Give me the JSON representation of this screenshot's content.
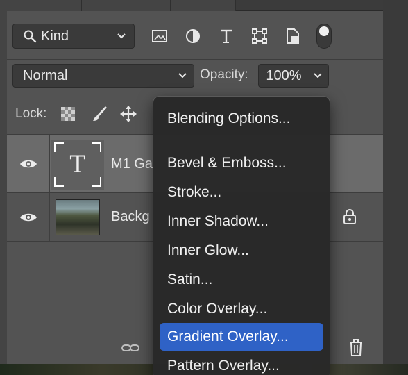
{
  "filter": {
    "kind_label": "Kind",
    "icons": [
      "image-filter-icon",
      "adjustment-filter-icon",
      "type-filter-icon",
      "shape-filter-icon",
      "smart-object-filter-icon",
      "filter-toggle"
    ]
  },
  "blend": {
    "mode": "Normal",
    "opacity_label": "Opacity:",
    "opacity_value": "100%"
  },
  "lock": {
    "label": "Lock:"
  },
  "layers": [
    {
      "name": "M1 Ga",
      "type": "text",
      "selected": true,
      "locked": false
    },
    {
      "name": "Backg",
      "type": "image",
      "selected": false,
      "locked": true
    }
  ],
  "context_menu": {
    "items": [
      "Blending Options...",
      "Bevel & Emboss...",
      "Stroke...",
      "Inner Shadow...",
      "Inner Glow...",
      "Satin...",
      "Color Overlay...",
      "Gradient Overlay...",
      "Pattern Overlay..."
    ],
    "highlighted": "Gradient Overlay...",
    "highlight_color": "#2f62c6"
  },
  "thumb_glyph": "T"
}
